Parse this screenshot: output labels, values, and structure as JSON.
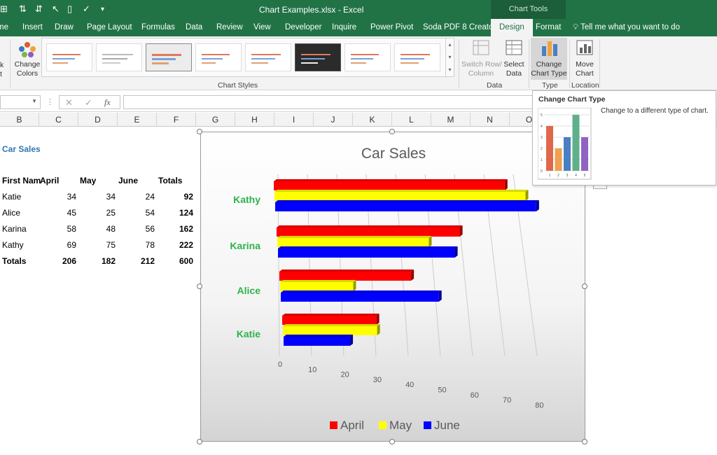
{
  "app": {
    "window_title": "Chart Examples.xlsx  -  Excel",
    "context_header": "Chart Tools"
  },
  "tabs": [
    {
      "label": "me"
    },
    {
      "label": "Insert"
    },
    {
      "label": "Draw"
    },
    {
      "label": "Page Layout"
    },
    {
      "label": "Formulas"
    },
    {
      "label": "Data"
    },
    {
      "label": "Review"
    },
    {
      "label": "View"
    },
    {
      "label": "Developer"
    },
    {
      "label": "Inquire"
    },
    {
      "label": "Power Pivot"
    },
    {
      "label": "Soda PDF 8 Creator"
    },
    {
      "label": "Design"
    },
    {
      "label": "Format"
    }
  ],
  "tell_me": "Tell me what you want to do",
  "ribbon": {
    "left_partial_1": "k",
    "left_partial_2": "t",
    "change_colors_1": "Change",
    "change_colors_2": "Colors",
    "chart_styles_label": "Chart Styles",
    "switch_1": "Switch Row/",
    "switch_2": "Column",
    "select_1": "Select",
    "select_2": "Data",
    "data_group": "Data",
    "change_type_1": "Change",
    "change_type_2": "Chart Type",
    "type_group": "Type",
    "move_1": "Move",
    "move_2": "Chart",
    "location_group": "Location"
  },
  "formula_bar": {
    "cancel": "✕",
    "enter": "✓",
    "fx": "fx"
  },
  "columns": [
    "B",
    "C",
    "D",
    "E",
    "F",
    "G",
    "H",
    "I",
    "J",
    "K",
    "L",
    "M",
    "N",
    "O"
  ],
  "sheet": {
    "title": "Car Sales",
    "headers": [
      "First Nam",
      "April",
      "May",
      "June",
      "Totals"
    ],
    "rows": [
      {
        "name": "Katie",
        "april": "34",
        "may": "34",
        "june": "24",
        "total": "92"
      },
      {
        "name": "Alice",
        "april": "45",
        "may": "25",
        "june": "54",
        "total": "124"
      },
      {
        "name": "Karina",
        "april": "58",
        "may": "48",
        "june": "56",
        "total": "162"
      },
      {
        "name": "Kathy",
        "april": "69",
        "may": "75",
        "june": "78",
        "total": "222"
      }
    ],
    "totals": {
      "name": "Totals",
      "april": "206",
      "may": "182",
      "june": "212",
      "total": "600"
    }
  },
  "tooltip": {
    "title": "Change Chart Type",
    "description": "Change to a different type of chart.",
    "preview_ticks": [
      "0",
      "1",
      "2",
      "3",
      "4",
      "5"
    ],
    "preview_cats": [
      "1",
      "2",
      "3",
      "4",
      "5"
    ],
    "preview_values": [
      4,
      2,
      3,
      5,
      3
    ],
    "preview_colors": [
      "#e0684a",
      "#f0a050",
      "#4a7fc1",
      "#5fb08a",
      "#8f63c2"
    ]
  },
  "colors": {
    "excel_green": "#217346",
    "april": "#ff0000",
    "may": "#ffff00",
    "june": "#0000ff",
    "category_label": "#2db34a",
    "sheet_title": "#2e75b6"
  },
  "chart_data": {
    "type": "bar",
    "title": "Car Sales",
    "categories": [
      "Katie",
      "Alice",
      "Karina",
      "Kathy"
    ],
    "series": [
      {
        "name": "April",
        "values": [
          34,
          45,
          58,
          69
        ]
      },
      {
        "name": "May",
        "values": [
          34,
          25,
          48,
          75
        ]
      },
      {
        "name": "June",
        "values": [
          24,
          54,
          56,
          78
        ]
      }
    ],
    "xticks": [
      "0",
      "10",
      "20",
      "30",
      "40",
      "50",
      "60",
      "70",
      "80"
    ],
    "xlim": [
      0,
      80
    ],
    "orientation": "horizontal",
    "style": "3d",
    "legend": "bottom"
  }
}
